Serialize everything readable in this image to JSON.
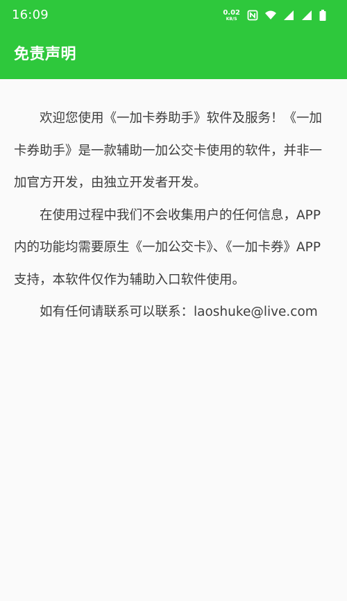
{
  "status_bar": {
    "time": "16:09",
    "net_speed": "0.02",
    "net_unit": "KB/S",
    "icons": [
      "nfc-icon",
      "wifi-icon",
      "cell-signal-icon",
      "cell-signal-2-icon",
      "battery-icon"
    ]
  },
  "app_bar": {
    "title": "免责声明",
    "color": "#2ec83c"
  },
  "content": {
    "paragraphs": [
      "欢迎您使用《一加卡券助手》软件及服务！《一加卡券助手》是一款辅助一加公交卡使用的软件，并非一加官方开发，由独立开发者开发。",
      "在使用过程中我们不会收集用户的任何信息，APP内的功能均需要原生《一加公交卡》、《一加卡券》APP支持，本软件仅作为辅助入口软件使用。",
      "如有任何请联系可以联系：laoshuke@live.com"
    ]
  }
}
